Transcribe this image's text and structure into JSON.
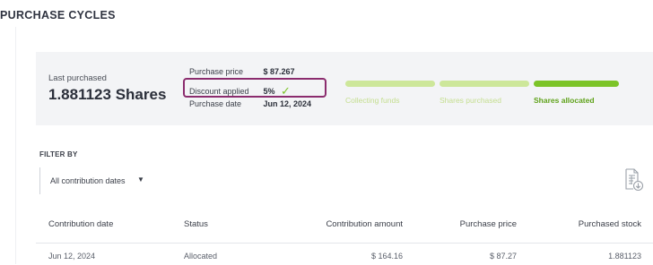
{
  "page": {
    "title": "PURCHASE CYCLES"
  },
  "summary": {
    "last_purchased_label": "Last purchased",
    "last_purchased_value": "1.881123 Shares",
    "purchase_price_label": "Purchase price",
    "purchase_price_value": "$ 87.267",
    "discount_label": "Discount applied",
    "discount_value": "5%",
    "discount_icon": "checkmark-icon",
    "purchase_date_label": "Purchase date",
    "purchase_date_value": "Jun 12, 2024"
  },
  "progress": {
    "stages": [
      {
        "label": "Collecting funds",
        "state": "complete"
      },
      {
        "label": "Shares purchased",
        "state": "complete"
      },
      {
        "label": "Shares allocated",
        "state": "current"
      }
    ],
    "colors": {
      "complete": "#cde79a",
      "current": "#7cc428"
    }
  },
  "filter": {
    "title": "FILTER BY",
    "selected": "All contribution dates"
  },
  "export": {
    "icon": "export-document-icon"
  },
  "table": {
    "headers": [
      "Contribution date",
      "Status",
      "Contribution amount",
      "Purchase price",
      "Purchased stock"
    ],
    "rows": [
      [
        "Jun 12, 2024",
        "Allocated",
        "$ 164.16",
        "$ 87.27",
        "1.881123"
      ]
    ]
  },
  "colors": {
    "accent_green": "#7cc428",
    "highlight_border": "#8b2c6e",
    "summary_bg": "#f3f4f6"
  }
}
